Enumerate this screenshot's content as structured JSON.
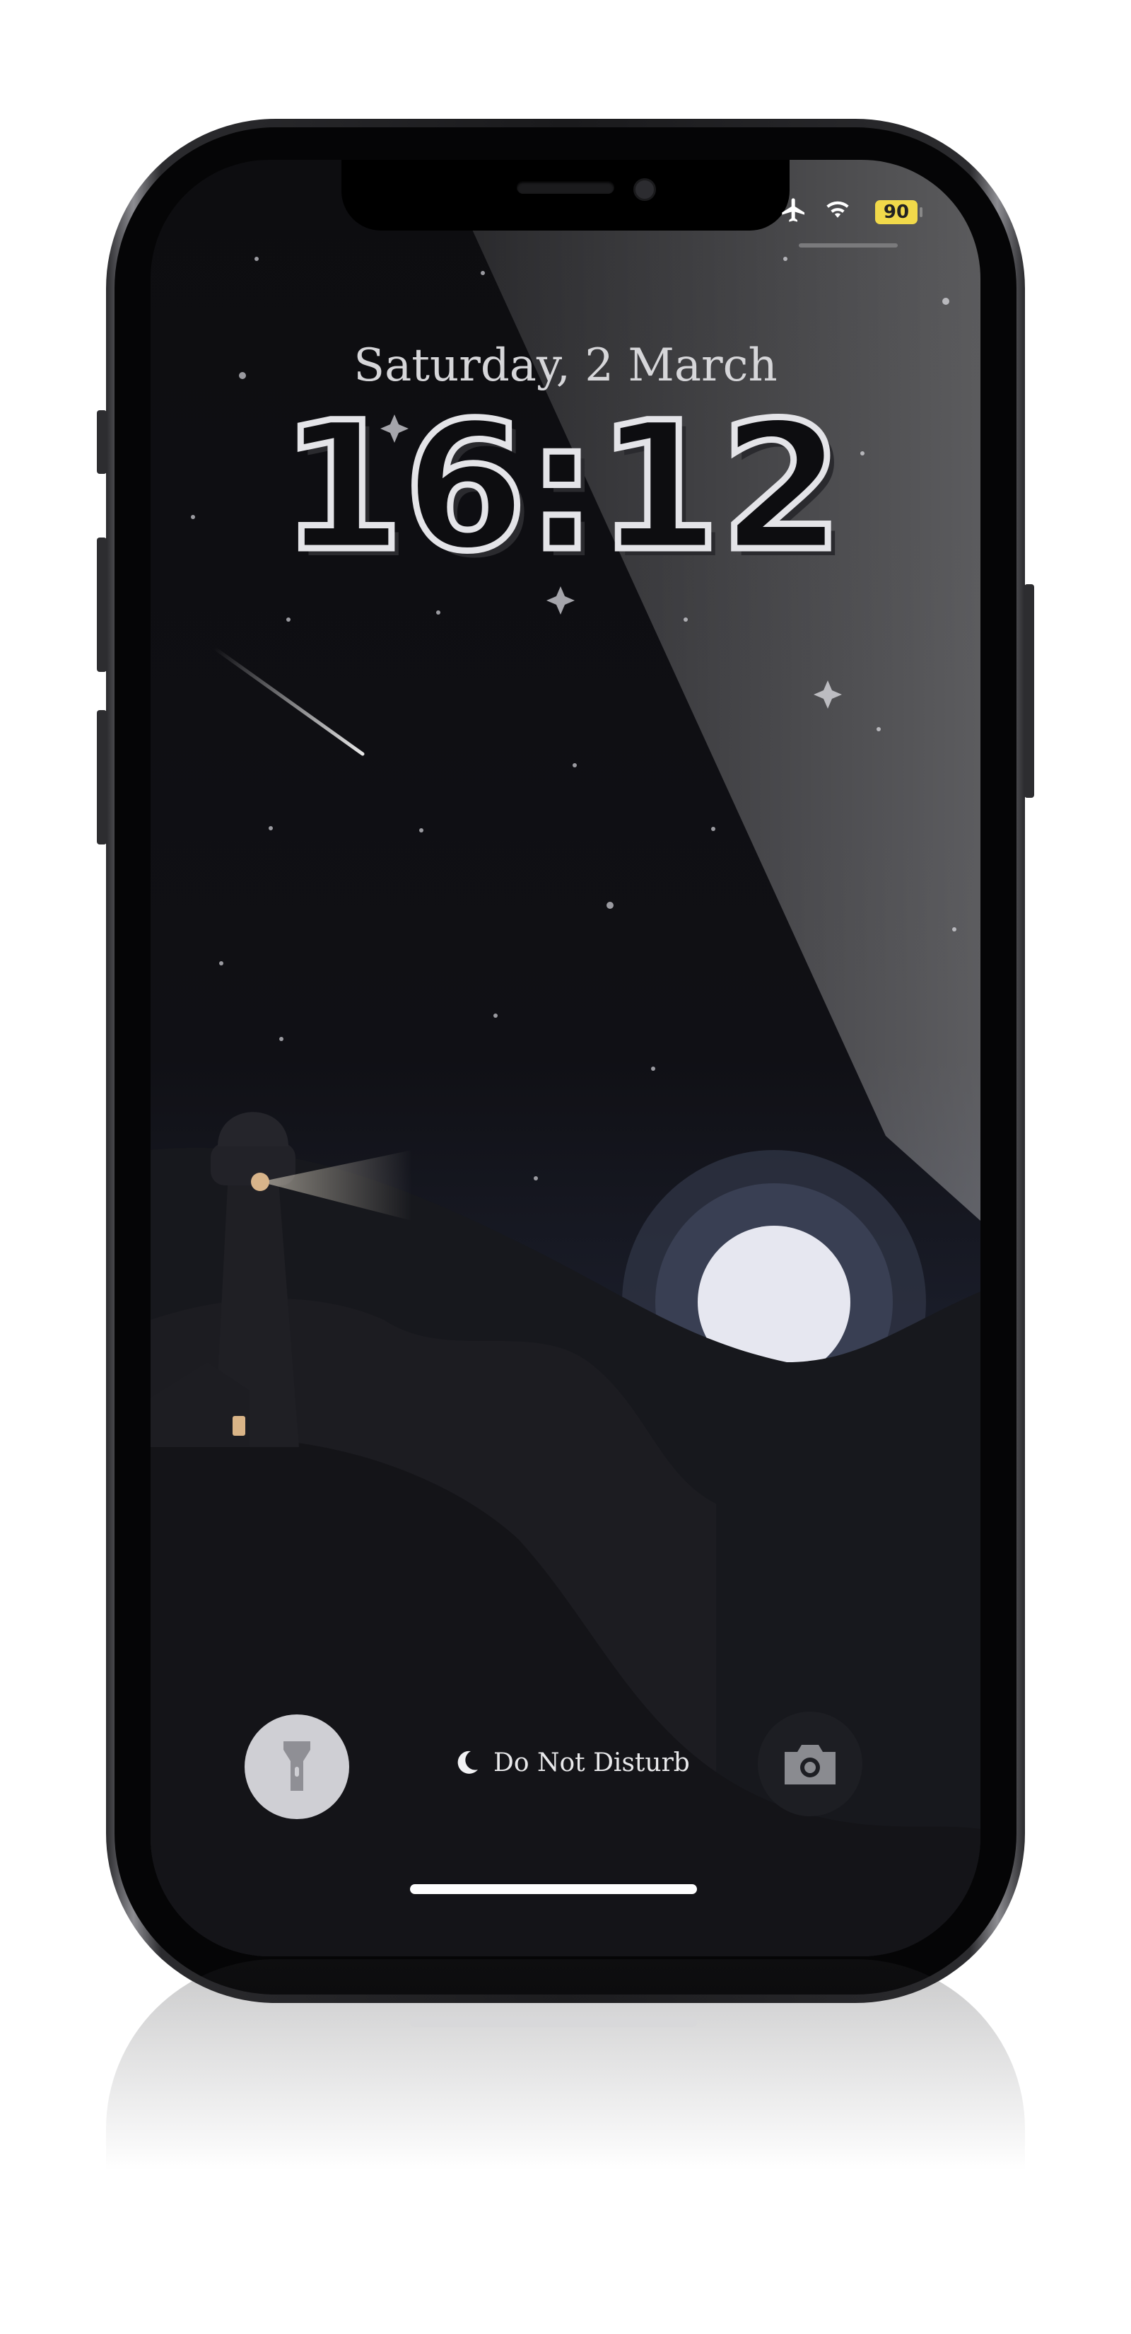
{
  "status_bar": {
    "icons": [
      "airplane-icon",
      "wifi-icon"
    ],
    "battery_level": "90"
  },
  "lock_screen": {
    "date": "Saturday, 2 March",
    "time": "16:12"
  },
  "controls": {
    "flashlight_icon": "flashlight-icon",
    "do_not_disturb_label": "Do Not Disturb",
    "camera_icon": "camera-icon"
  },
  "colors": {
    "battery": "#f1d94a",
    "wallpaper_dark": "#0d0d10",
    "moon": "#e6e7f0"
  }
}
